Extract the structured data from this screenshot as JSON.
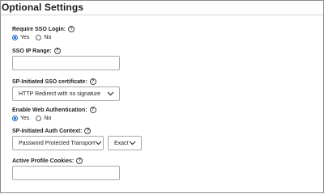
{
  "section": {
    "title": "Optional Settings"
  },
  "help_icon_glyph": "?",
  "require_sso_login": {
    "label": "Require SSO Login:",
    "options": [
      {
        "label": "Yes",
        "selected": true
      },
      {
        "label": "No",
        "selected": false
      }
    ]
  },
  "sso_ip_range": {
    "label": "SSO IP Range:",
    "value": ""
  },
  "sp_initiated_sso_certificate": {
    "label": "SP-Initiated SSO certificate:",
    "selected": "HTTP Redirect with no signature"
  },
  "enable_web_authentication": {
    "label": "Enable Web Authentication:",
    "options": [
      {
        "label": "Yes",
        "selected": true
      },
      {
        "label": "No",
        "selected": false
      }
    ]
  },
  "sp_initiated_auth_context": {
    "label": "SP-Initiated Auth Context:",
    "context_selected": "Password Protected Transport",
    "comparison_selected": "Exact"
  },
  "active_profile_cookies": {
    "label": "Active Profile Cookies:",
    "value": ""
  },
  "colors": {
    "accent": "#1565c0",
    "border": "#a9a9a9"
  }
}
